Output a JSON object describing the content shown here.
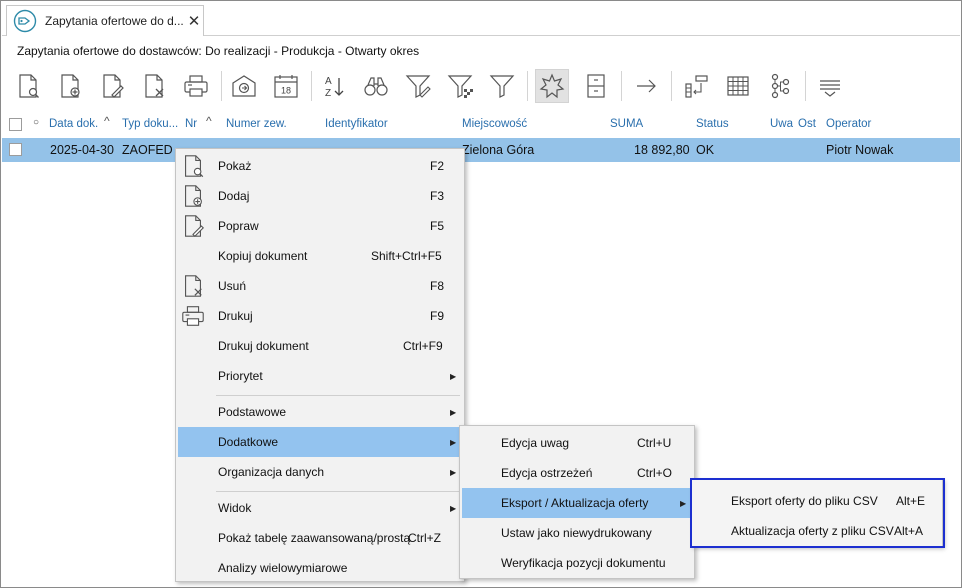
{
  "tab": {
    "title": "Zapytania ofertowe do d...",
    "close": "✕"
  },
  "heading": "Zapytania ofertowe do dostawców: Do realizacji - Produkcja - Otwarty okres",
  "toolbar": {
    "sort_a": "A",
    "sort_z": "Z",
    "calendar_day": "18"
  },
  "columns": {
    "data_dok": "Data dok.",
    "typ_dok": "Typ doku...",
    "nr": "Nr",
    "numer_zew": "Numer zew.",
    "identyfikator": "Identyfikator",
    "miejscowosc": "Miejscowość",
    "suma": "SUMA",
    "status": "Status",
    "uwa": "Uwa",
    "ost": "Ost",
    "operator": "Operator"
  },
  "row": {
    "data_dok": "2025-04-30",
    "typ_dok": "ZAOFED",
    "miejscowosc": "Zielona Góra",
    "suma": "18 892,80",
    "status": "OK",
    "operator": "Piotr Nowak"
  },
  "context_menu": {
    "items": [
      {
        "label": "Pokaż",
        "shortcut": "F2"
      },
      {
        "label": "Dodaj",
        "shortcut": "F3"
      },
      {
        "label": "Popraw",
        "shortcut": "F5"
      },
      {
        "label": "Kopiuj dokument",
        "shortcut": "Shift+Ctrl+F5"
      },
      {
        "label": "Usuń",
        "shortcut": "F8"
      },
      {
        "label": "Drukuj",
        "shortcut": "F9"
      },
      {
        "label": "Drukuj dokument",
        "shortcut": "Ctrl+F9"
      },
      {
        "label": "Priorytet",
        "shortcut": ""
      },
      {
        "label": "Podstawowe",
        "shortcut": ""
      },
      {
        "label": "Dodatkowe",
        "shortcut": ""
      },
      {
        "label": "Organizacja danych",
        "shortcut": ""
      },
      {
        "label": "Widok",
        "shortcut": ""
      },
      {
        "label": "Pokaż tabelę zaawansowaną/prostą",
        "shortcut": "Ctrl+Z"
      },
      {
        "label": "Analizy wielowymiarowe",
        "shortcut": ""
      }
    ]
  },
  "submenu_dodatkowe": {
    "items": [
      {
        "label": "Edycja uwag",
        "shortcut": "Ctrl+U"
      },
      {
        "label": "Edycja ostrzeżeń",
        "shortcut": "Ctrl+O"
      },
      {
        "label": "Eksport / Aktualizacja oferty",
        "shortcut": ""
      },
      {
        "label": "Ustaw jako niewydrukowany",
        "shortcut": ""
      },
      {
        "label": "Weryfikacja pozycji dokumentu",
        "shortcut": ""
      }
    ]
  },
  "submenu_eksport": {
    "items": [
      {
        "label": "Eksport oferty do pliku CSV",
        "shortcut": "Alt+E"
      },
      {
        "label": "Aktualizacja oferty z pliku CSV",
        "shortcut": "Alt+A"
      }
    ]
  },
  "colors": {
    "selection": "#94c2e8",
    "menu_highlight": "#93c3ef",
    "header_text": "#2a6fad",
    "annotation_box": "#1c2fd0"
  }
}
